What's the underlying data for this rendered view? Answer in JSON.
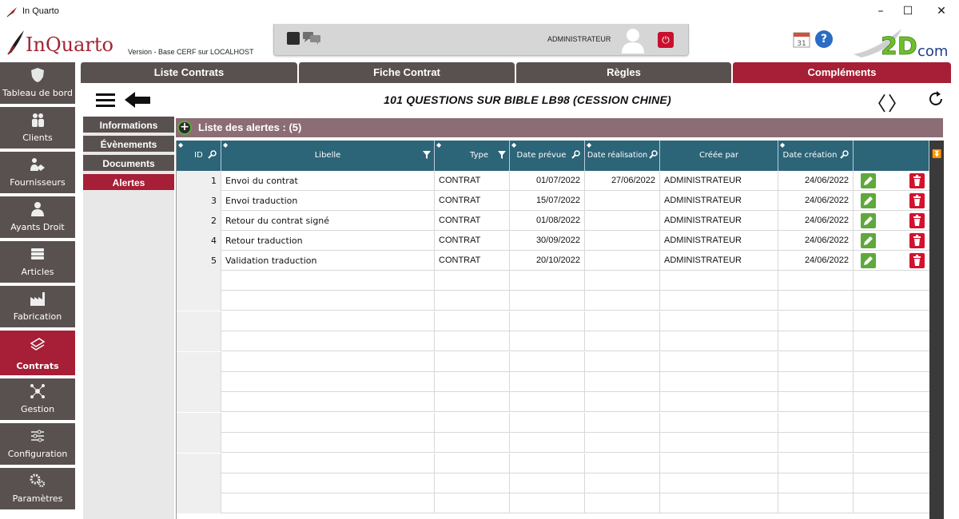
{
  "window": {
    "title": "In Quarto"
  },
  "header": {
    "logo_text": "InQuarto",
    "version": "Version  - Base CERF sur LOCALHOST",
    "username": "ADMINISTRATEUR",
    "calendar_day": "31",
    "help": "?",
    "brand": "2Dcom"
  },
  "sidebar": {
    "items": [
      {
        "label": "Tableau de bord",
        "icon": "shield-icon"
      },
      {
        "label": "Clients",
        "icon": "users-icon"
      },
      {
        "label": "Fournisseurs",
        "icon": "handshake-icon"
      },
      {
        "label": "Ayants Droit",
        "icon": "person-icon"
      },
      {
        "label": "Articles",
        "icon": "books-icon"
      },
      {
        "label": "Fabrication",
        "icon": "factory-icon"
      },
      {
        "label": "Contrats",
        "icon": "contract-icon",
        "active": true
      },
      {
        "label": "Gestion",
        "icon": "network-icon"
      },
      {
        "label": "Configuration",
        "icon": "sliders-icon"
      },
      {
        "label": "Paramètres",
        "icon": "gears-icon"
      }
    ]
  },
  "tabs": [
    {
      "label": "Liste Contrats"
    },
    {
      "label": "Fiche Contrat"
    },
    {
      "label": "Règles"
    },
    {
      "label": "Compléments",
      "active": true
    }
  ],
  "content": {
    "title": "101 QUESTIONS SUR BIBLE   LB98 (CESSION CHINE)",
    "prev": "〈",
    "next": "〉"
  },
  "subnav": [
    {
      "label": "Informations"
    },
    {
      "label": "Évènements"
    },
    {
      "label": "Documents"
    },
    {
      "label": "Alertes",
      "active": true
    }
  ],
  "list": {
    "title": "Liste des alertes : (5)",
    "add": "+",
    "columns": [
      "ID",
      "Libelle",
      "Type",
      "Date prévue",
      "Date réalisation",
      "Créée par",
      "Date création"
    ],
    "rows": [
      {
        "id": "1",
        "libelle": "Envoi du contrat",
        "type": "CONTRAT",
        "date_prevue": "01/07/2022",
        "date_realisation": "27/06/2022",
        "creee_par": "ADMINISTRATEUR",
        "date_creation": "24/06/2022"
      },
      {
        "id": "3",
        "libelle": "Envoi traduction",
        "type": "CONTRAT",
        "date_prevue": "15/07/2022",
        "date_realisation": "",
        "creee_par": "ADMINISTRATEUR",
        "date_creation": "24/06/2022"
      },
      {
        "id": "2",
        "libelle": "Retour du contrat signé",
        "type": "CONTRAT",
        "date_prevue": "01/08/2022",
        "date_realisation": "",
        "creee_par": "ADMINISTRATEUR",
        "date_creation": "24/06/2022"
      },
      {
        "id": "4",
        "libelle": "Retour traduction",
        "type": "CONTRAT",
        "date_prevue": "30/09/2022",
        "date_realisation": "",
        "creee_par": "ADMINISTRATEUR",
        "date_creation": "24/06/2022"
      },
      {
        "id": "5",
        "libelle": "Validation traduction",
        "type": "CONTRAT",
        "date_prevue": "20/10/2022",
        "date_realisation": "",
        "creee_par": "ADMINISTRATEUR",
        "date_creation": "24/06/2022"
      }
    ]
  },
  "colors": {
    "accent": "#a61f36",
    "nav": "#595150",
    "grid_header": "#2c6478",
    "edit": "#5fa83c",
    "delete": "#d3122e"
  }
}
